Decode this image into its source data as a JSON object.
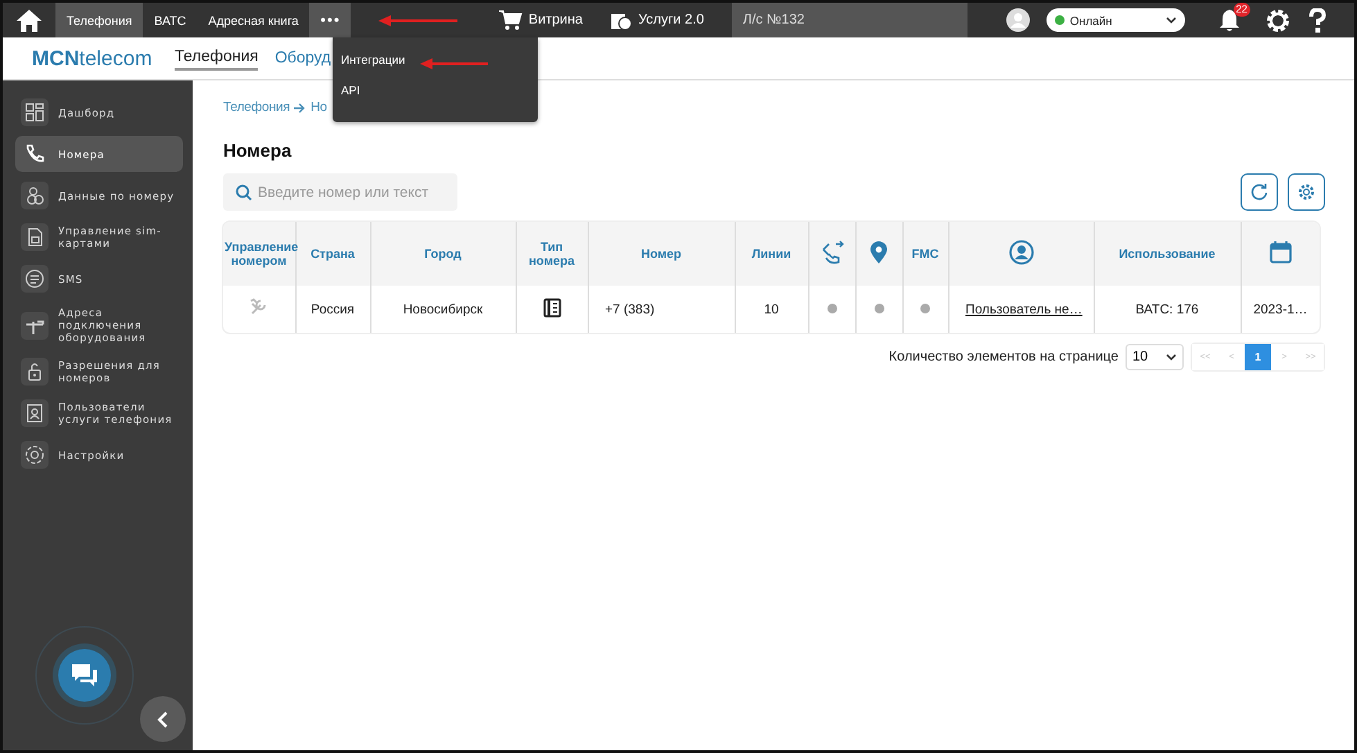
{
  "topbar": {
    "tabs": [
      {
        "label": "Телефония",
        "selected": true
      },
      {
        "label": "ВАТС",
        "selected": false
      },
      {
        "label": "Адресная книга",
        "selected": false
      }
    ],
    "more_button": {
      "label": "•••",
      "expanded": true
    },
    "links": [
      "Витрина",
      "Услуги 2.0"
    ],
    "account_field": {
      "value": "Л/с №132"
    },
    "status_select": {
      "value": "Онлайн"
    },
    "notifications_badge": "22"
  },
  "more_menu": {
    "items": [
      "Интеграции",
      "API"
    ]
  },
  "subbar": {
    "logo": "**MCN**telecom",
    "tabs": [
      {
        "label": "Телефония",
        "selected": true
      },
      {
        "label": "Оборуд",
        "selected": false
      }
    ]
  },
  "sidebar": {
    "items": [
      {
        "label": "Дашборд",
        "selected": false
      },
      {
        "label": "Номера",
        "selected": true
      },
      {
        "label": "Данные по номеру",
        "selected": false
      },
      {
        "label": "Управление sim-картами",
        "selected": false
      },
      {
        "label": "SMS",
        "selected": false
      },
      {
        "label": "Адреса подключения оборудования",
        "selected": false
      },
      {
        "label": "Разрешения для номеров",
        "selected": false
      },
      {
        "label": "Пользователи услуги телефония",
        "selected": false
      },
      {
        "label": "Настройки",
        "selected": false
      }
    ]
  },
  "breadcrumb": [
    "Телефония",
    "Но"
  ],
  "page_title": "Номера",
  "search": {
    "placeholder": "Введите номер или текст"
  },
  "table": {
    "columns": [
      {
        "kind": "text",
        "label": "Управление номером"
      },
      {
        "kind": "text",
        "label": "Страна"
      },
      {
        "kind": "text",
        "label": "Город"
      },
      {
        "kind": "text",
        "label": "Тип номера"
      },
      {
        "kind": "text",
        "label": "Номер"
      },
      {
        "kind": "text",
        "label": "Линии"
      },
      {
        "kind": "icon"
      },
      {
        "kind": "icon"
      },
      {
        "kind": "text",
        "label": "FMC"
      },
      {
        "kind": "icon"
      },
      {
        "kind": "text",
        "label": "Использование"
      },
      {
        "kind": "icon"
      }
    ],
    "rows": [
      {
        "cells": [
          {
            "kind": "tool"
          },
          {
            "kind": "text",
            "text": "Россия"
          },
          {
            "kind": "text",
            "text": "Новосибирск"
          },
          {
            "kind": "phone"
          },
          {
            "kind": "text",
            "text": "+7 (383)"
          },
          {
            "kind": "text",
            "text": "10"
          },
          {
            "kind": "dot",
            "on": false
          },
          {
            "kind": "dot",
            "on": false
          },
          {
            "kind": "dot",
            "on": false
          },
          {
            "kind": "link",
            "text": "Пользователь не…"
          },
          {
            "kind": "text",
            "text": "ВАТС: 176"
          },
          {
            "kind": "text",
            "text": "2023-1…"
          }
        ]
      }
    ]
  },
  "pagination": {
    "label": "Количество элементов на странице",
    "page_size": "10",
    "pages": [
      {
        "label": "<<",
        "selected": false
      },
      {
        "label": "<",
        "selected": false
      },
      {
        "label": "1",
        "selected": true
      },
      {
        "label": ">",
        "selected": false
      },
      {
        "label": ">>",
        "selected": false
      }
    ]
  }
}
